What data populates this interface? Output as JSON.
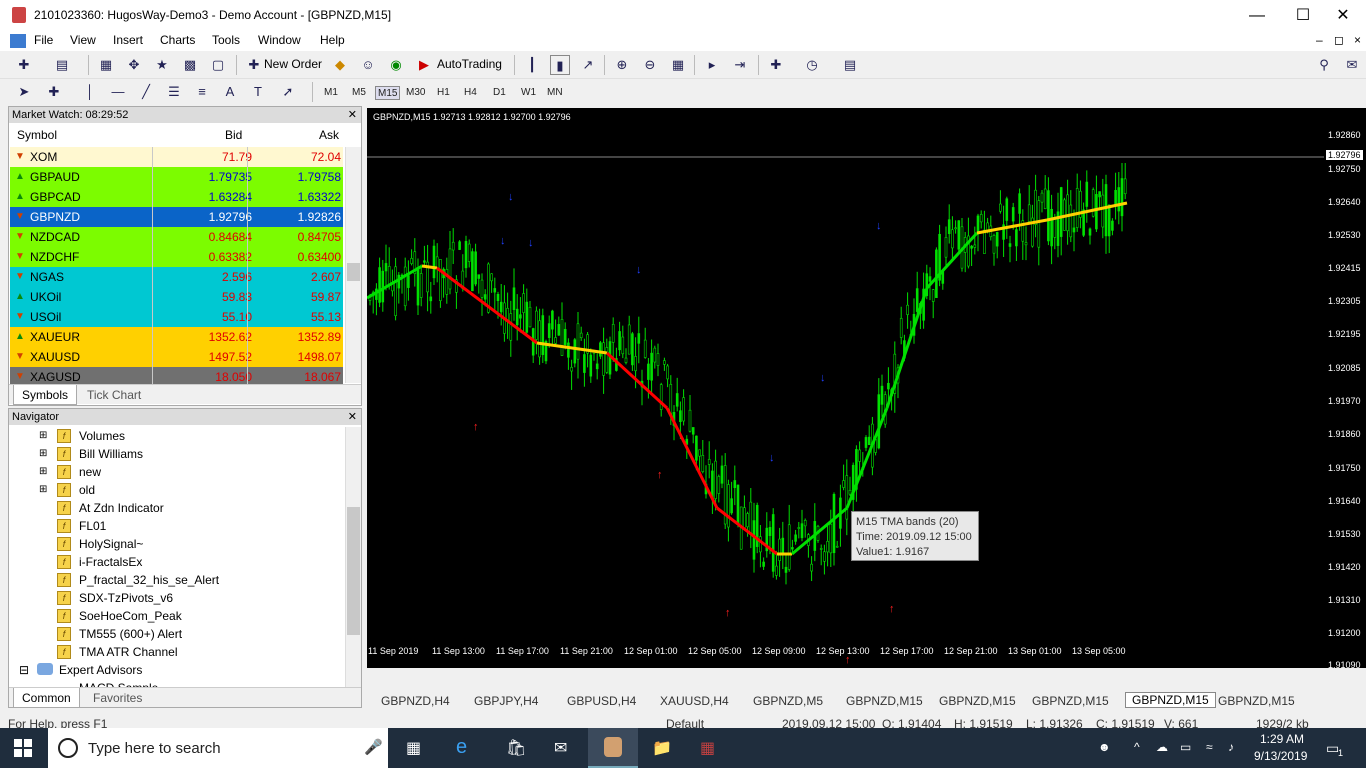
{
  "window": {
    "title": "2101023360: HugosWay-Demo3 - Demo Account - [GBPNZD,M15]"
  },
  "menu": [
    "File",
    "View",
    "Insert",
    "Charts",
    "Tools",
    "Window",
    "Help"
  ],
  "toolbar": {
    "new_order": "New Order",
    "autotrading": "AutoTrading",
    "timeframes": [
      "M1",
      "M5",
      "M15",
      "M30",
      "H1",
      "H4",
      "D1",
      "W1",
      "MN"
    ],
    "selected_timeframe": "M15"
  },
  "market_watch": {
    "title": "Market Watch: 08:29:52",
    "headers": {
      "symbol": "Symbol",
      "bid": "Bid",
      "ask": "Ask"
    },
    "rows": [
      {
        "symbol": "XOM",
        "bid": "71.79",
        "ask": "72.04",
        "dir": "down",
        "bg": "#fff8d0",
        "fg": "#e00000"
      },
      {
        "symbol": "GBPAUD",
        "bid": "1.79735",
        "ask": "1.79758",
        "dir": "up",
        "bg": "#7cfc00",
        "fg": "#0000cc"
      },
      {
        "symbol": "GBPCAD",
        "bid": "1.63284",
        "ask": "1.63322",
        "dir": "up",
        "bg": "#7cfc00",
        "fg": "#0000cc"
      },
      {
        "symbol": "GBPNZD",
        "bid": "1.92796",
        "ask": "1.92826",
        "dir": "down",
        "bg": "#0a64c8",
        "fg": "#ffffff"
      },
      {
        "symbol": "NZDCAD",
        "bid": "0.84684",
        "ask": "0.84705",
        "dir": "down",
        "bg": "#7cfc00",
        "fg": "#e00000"
      },
      {
        "symbol": "NZDCHF",
        "bid": "0.63382",
        "ask": "0.63400",
        "dir": "down",
        "bg": "#7cfc00",
        "fg": "#e00000"
      },
      {
        "symbol": "NGAS",
        "bid": "2.596",
        "ask": "2.607",
        "dir": "down",
        "bg": "#00c8d2",
        "fg": "#e00000"
      },
      {
        "symbol": "UKOil",
        "bid": "59.83",
        "ask": "59.87",
        "dir": "up",
        "bg": "#00c8d2",
        "fg": "#e00000"
      },
      {
        "symbol": "USOil",
        "bid": "55.10",
        "ask": "55.13",
        "dir": "down",
        "bg": "#00c8d2",
        "fg": "#e00000"
      },
      {
        "symbol": "XAUEUR",
        "bid": "1352.62",
        "ask": "1352.89",
        "dir": "up",
        "bg": "#ffd000",
        "fg": "#e00000"
      },
      {
        "symbol": "XAUUSD",
        "bid": "1497.52",
        "ask": "1498.07",
        "dir": "down",
        "bg": "#ffd000",
        "fg": "#e00000"
      },
      {
        "symbol": "XAGUSD",
        "bid": "18.050",
        "ask": "18.067",
        "dir": "down",
        "bg": "#707070",
        "fg": "#e00000"
      }
    ],
    "tabs": [
      "Symbols",
      "Tick Chart"
    ]
  },
  "navigator": {
    "title": "Navigator",
    "items": [
      {
        "label": "Volumes",
        "expander": true
      },
      {
        "label": "Bill Williams",
        "expander": true
      },
      {
        "label": "new",
        "expander": true
      },
      {
        "label": "old",
        "expander": true
      },
      {
        "label": "At Zdn Indicator",
        "expander": false
      },
      {
        "label": "FL01",
        "expander": false
      },
      {
        "label": "HolySignal~",
        "expander": false
      },
      {
        "label": "i-FractalsEx",
        "expander": false
      },
      {
        "label": "P_fractal_32_his_se_Alert",
        "expander": false
      },
      {
        "label": "SDX-TzPivots_v6",
        "expander": false
      },
      {
        "label": "SoeHoeCom_Peak",
        "expander": false
      },
      {
        "label": "TM555 (600+) Alert",
        "expander": false
      },
      {
        "label": "TMA ATR Channel",
        "expander": false
      }
    ],
    "expert_advisors": "Expert Advisors",
    "partial_item": "MACD Sample",
    "tabs": [
      "Common",
      "Favorites"
    ]
  },
  "chart": {
    "header": "GBPNZD,M15  1.92713 1.92812 1.92700 1.92796",
    "price_labels": [
      "1.92860",
      "1.92796",
      "1.92750",
      "1.92640",
      "1.92530",
      "1.92415",
      "1.92305",
      "1.92195",
      "1.92085",
      "1.91970",
      "1.91860",
      "1.91750",
      "1.91640",
      "1.91530",
      "1.91420",
      "1.91310",
      "1.91200",
      "1.91090"
    ],
    "current_price": "1.92796",
    "time_labels": [
      "11 Sep 2019",
      "11 Sep 13:00",
      "11 Sep 17:00",
      "11 Sep 21:00",
      "12 Sep 01:00",
      "12 Sep 05:00",
      "12 Sep 09:00",
      "12 Sep 13:00",
      "12 Sep 17:00",
      "12 Sep 21:00",
      "13 Sep 01:00",
      "13 Sep 05:00"
    ],
    "tooltip": {
      "line1": "M15 TMA bands (20)",
      "line2": "Time: 2019.09.12 15:00",
      "line3": "Value1: 1.9167"
    }
  },
  "chart_tabs": [
    "GBPNZD,H4",
    "GBPJPY,H4",
    "GBPUSD,H4",
    "XAUUSD,H4",
    "GBPNZD,M5",
    "GBPNZD,M15",
    "GBPNZD,M15",
    "GBPNZD,M15",
    "GBPNZD,M15",
    "GBPNZD,M15"
  ],
  "active_chart_tab": 8,
  "status": {
    "help": "For Help, press F1",
    "profile": "Default",
    "time": "2019.09.12 15:00",
    "open": "O: 1.91404",
    "high": "H: 1.91519",
    "low": "L: 1.91326",
    "close": "C: 1.91519",
    "volume": "V: 661",
    "traffic": "1929/2 kb"
  },
  "taskbar": {
    "search_placeholder": "Type here to search",
    "time": "1:29 AM",
    "date": "9/13/2019",
    "notifications": "1"
  }
}
